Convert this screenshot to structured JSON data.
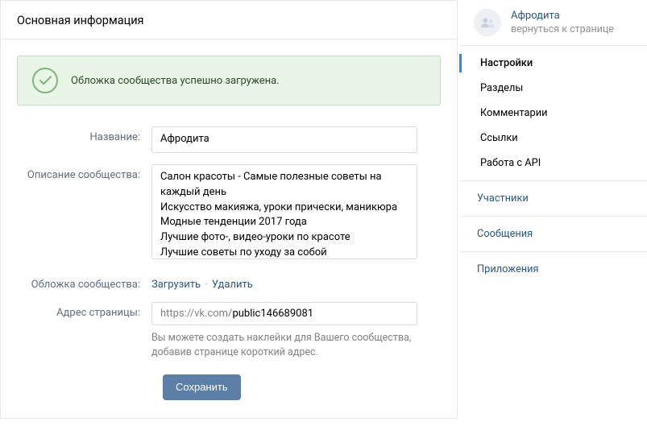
{
  "header": {
    "title": "Основная информация"
  },
  "success": {
    "message": "Обложка сообщества успешно загружена."
  },
  "form": {
    "name": {
      "label": "Название:",
      "value": "Афродита"
    },
    "description": {
      "label": "Описание сообщества:",
      "value": "Салон красоты - Самые полезные советы на каждый день\nИскусство макияжа, уроки прически, маникюра\nМодные тенденции 2017 года\nЛучшие фото-, видео-уроки по красоте\nЛучшие советы по уходу за собой"
    },
    "cover": {
      "label": "Обложка сообщества:",
      "upload": "Загрузить",
      "delete": "Удалить"
    },
    "url": {
      "label": "Адрес страницы:",
      "prefix": "https://vk.com/",
      "value": "public146689081",
      "hint": "Вы можете создать наклейки для Вашего сообщества, добавив странице короткий адрес."
    },
    "save": "Сохранить"
  },
  "sidebar": {
    "profile": {
      "name": "Афродита",
      "subtitle": "вернуться к странице"
    },
    "tabs": {
      "settings": "Настройки",
      "sections": "Разделы",
      "comments": "Комментарии",
      "links": "Ссылки",
      "api": "Работа с API"
    },
    "members": "Участники",
    "messages": "Сообщения",
    "apps": "Приложения"
  }
}
